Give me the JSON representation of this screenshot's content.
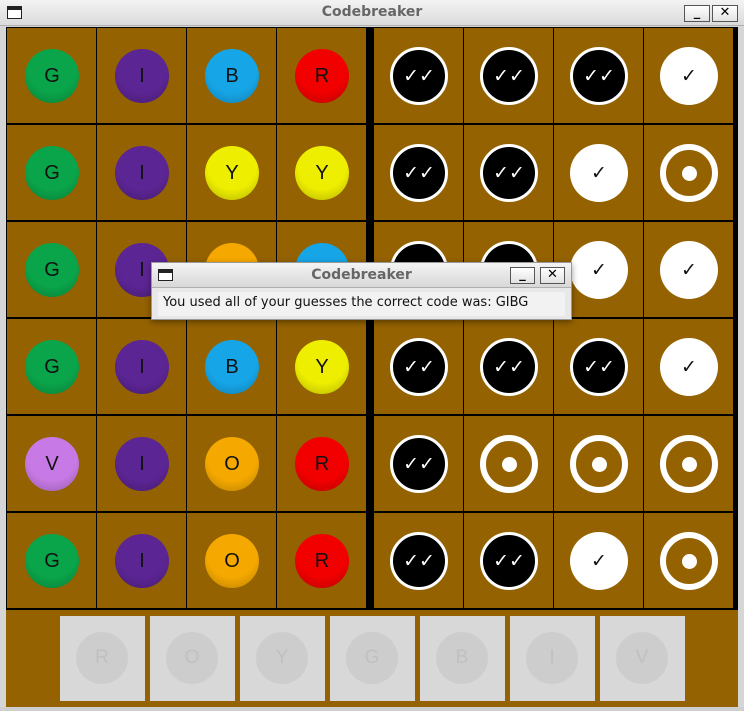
{
  "window": {
    "title": "Codebreaker",
    "minimize_label": "_",
    "close_label": "✕"
  },
  "colors": {
    "G": "#0aa54a",
    "I": "#5c2594",
    "B": "#16a6e8",
    "R": "#f20000",
    "Y": "#eeee00",
    "O": "#f5a900",
    "V": "#c77ae5",
    "board": "#946200"
  },
  "guesses": [
    {
      "pegs": [
        "G",
        "I",
        "B",
        "R"
      ],
      "feedback": [
        "black",
        "black",
        "black",
        "white"
      ]
    },
    {
      "pegs": [
        "G",
        "I",
        "Y",
        "Y"
      ],
      "feedback": [
        "black",
        "black",
        "white",
        "empty"
      ]
    },
    {
      "pegs": [
        "G",
        "I",
        "O",
        "B"
      ],
      "feedback": [
        "black",
        "black",
        "white",
        "white"
      ]
    },
    {
      "pegs": [
        "G",
        "I",
        "B",
        "Y"
      ],
      "feedback": [
        "black",
        "black",
        "black",
        "white"
      ]
    },
    {
      "pegs": [
        "V",
        "I",
        "O",
        "R"
      ],
      "feedback": [
        "black",
        "empty",
        "empty",
        "empty"
      ]
    },
    {
      "pegs": [
        "G",
        "I",
        "O",
        "R"
      ],
      "feedback": [
        "black",
        "black",
        "white",
        "empty"
      ]
    }
  ],
  "feedback_symbols": {
    "black": "✓✓",
    "white": "✓",
    "empty": ""
  },
  "palette": [
    "R",
    "O",
    "Y",
    "G",
    "B",
    "I",
    "V"
  ],
  "dialog": {
    "title": "Codebreaker",
    "message": "You used all of your guesses the correct code was: GIBG",
    "minimize_label": "_",
    "close_label": "✕"
  }
}
